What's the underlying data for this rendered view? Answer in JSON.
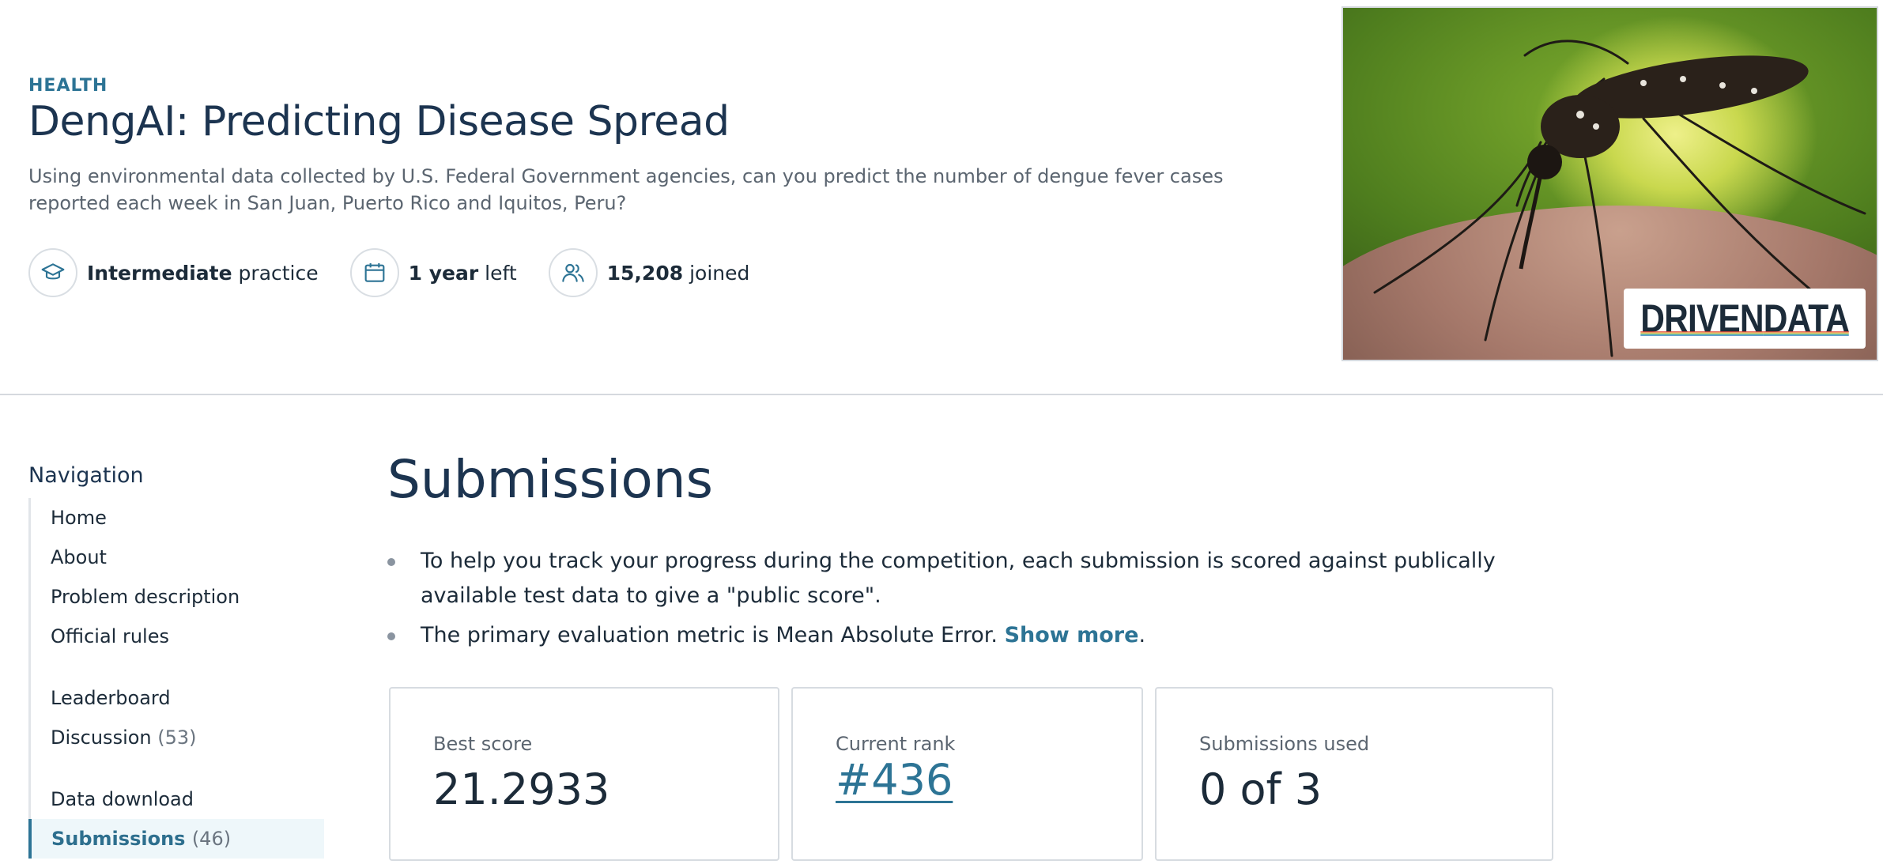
{
  "competition": {
    "category": "HEALTH",
    "title": "DengAI: Predicting Disease Spread",
    "description": "Using environmental data collected by U.S. Federal Government agencies, can you predict the number of dengue fever cases reported each week in San Juan, Puerto Rico and Iquitos, Peru?",
    "meta": [
      {
        "icon": "graduation-cap-icon",
        "bold": "Intermediate",
        "text": " practice"
      },
      {
        "icon": "calendar-icon",
        "bold": "1 year",
        "text": " left"
      },
      {
        "icon": "users-icon",
        "bold": "15,208",
        "text": " joined"
      }
    ],
    "hero_brand": {
      "left": "DRIVEN",
      "right": "DATA"
    }
  },
  "sidebar": {
    "title": "Navigation",
    "groups": [
      [
        {
          "label": "Home"
        },
        {
          "label": "About"
        },
        {
          "label": "Problem description"
        },
        {
          "label": "Official rules"
        }
      ],
      [
        {
          "label": "Leaderboard"
        },
        {
          "label": "Discussion",
          "count": "(53)"
        }
      ],
      [
        {
          "label": "Data download"
        },
        {
          "label": "Submissions",
          "count": "(46)",
          "active": true
        }
      ]
    ]
  },
  "main": {
    "title": "Submissions",
    "bullets": [
      "To help you track your progress during the competition, each submission is scored against publically available test data to give a \"public score\".",
      "The primary evaluation metric is Mean Absolute Error. "
    ],
    "show_more": "Show more",
    "show_more_after": ".",
    "cards": [
      {
        "label": "Best score",
        "value": "21.2933"
      },
      {
        "label": "Current rank",
        "value": "#436"
      },
      {
        "label": "Submissions used",
        "value": "0 of 3"
      }
    ]
  },
  "colors": {
    "accent": "#2d7495",
    "title": "#1c3450",
    "border": "#d7dce1"
  }
}
